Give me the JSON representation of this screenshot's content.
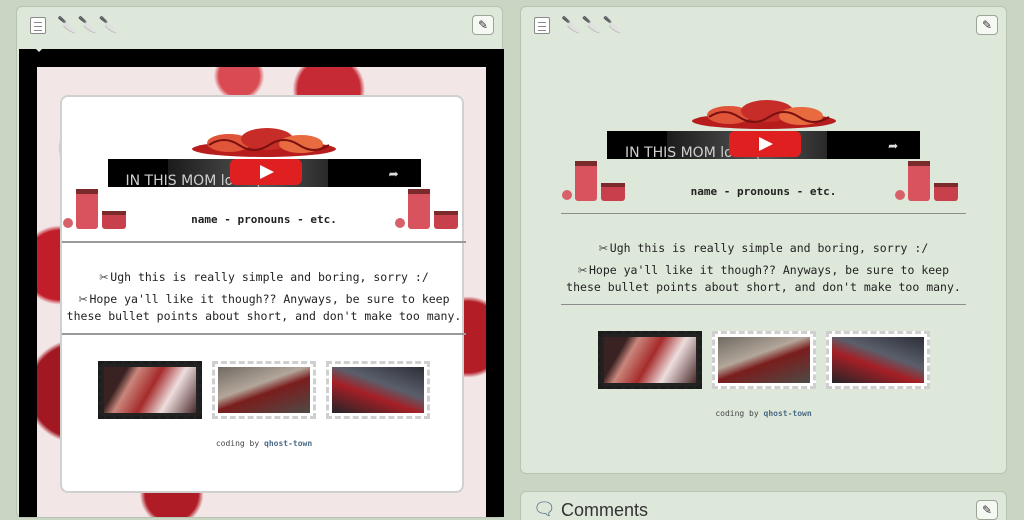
{
  "widget": {
    "knife_icons": "🔪🔪🔪",
    "edit_glyph": "✎"
  },
  "profile": {
    "video_title": "IN THIS MOM         lood (",
    "name_line": "name - pronouns - etc.",
    "bullet_icon": "✂",
    "bullets": [
      "Ugh this is really simple and boring, sorry :/",
      "Hope ya'll like it though?? Anyways, be sure to keep these bullet points about short, and don't make too many."
    ],
    "credit_prefix": "coding by",
    "credit_author": "qhost-town"
  },
  "comments": {
    "title": "Comments",
    "icon": "speech-bubble-icon",
    "edit_glyph": "✎"
  },
  "colors": {
    "blood": "#b3202a",
    "link": "#4b6a86",
    "youtube": "#e02020"
  }
}
